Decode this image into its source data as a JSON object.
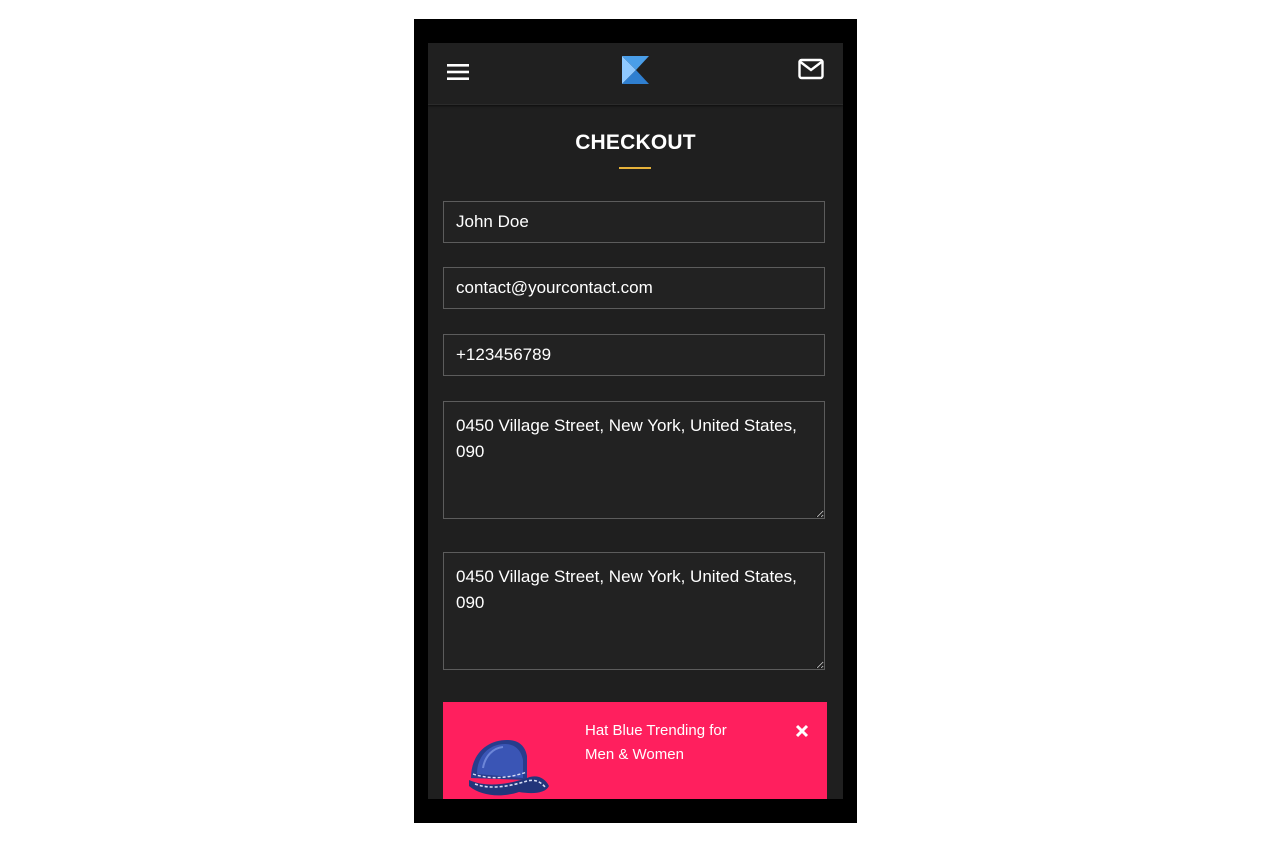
{
  "header": {
    "menu_icon": "hamburger-menu-icon",
    "logo_icon": "k-logo-icon",
    "mail_icon": "mail-envelope-icon"
  },
  "page": {
    "title": "CHECKOUT",
    "accent_color": "#e6b23a"
  },
  "form": {
    "name_value": "John Doe",
    "email_value": "contact@yourcontact.com",
    "phone_value": "+123456789",
    "address_1_value": "0450 Village Street, New York, United States, 090",
    "address_2_value": "0450 Village Street, New York, United States, 090"
  },
  "promo": {
    "text": "Hat Blue Trending for Men & Women",
    "background_color": "#ff1f5e",
    "image_icon": "blue-cap-icon",
    "close_icon": "close-icon"
  }
}
